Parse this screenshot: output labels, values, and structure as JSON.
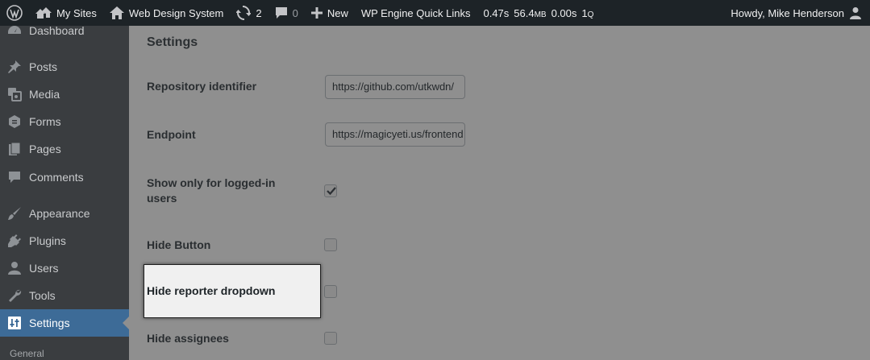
{
  "adminbar": {
    "my_sites": "My Sites",
    "site_name": "Web Design System",
    "updates_count": "2",
    "comments_count": "0",
    "new_label": "New",
    "wp_engine": "WP Engine Quick Links",
    "perf_time": "0.47s",
    "perf_memory_value": "56.4",
    "perf_memory_unit": "MB",
    "perf_db_time": "0.00s",
    "perf_queries_value": "1",
    "perf_queries_unit": "Q",
    "howdy": "Howdy, Mike Henderson"
  },
  "sidebar": {
    "items": [
      {
        "label": "Dashboard",
        "icon": "dashboard-icon"
      },
      {
        "label": "Posts",
        "icon": "pin-icon"
      },
      {
        "label": "Media",
        "icon": "media-icon"
      },
      {
        "label": "Forms",
        "icon": "forms-icon"
      },
      {
        "label": "Pages",
        "icon": "pages-icon"
      },
      {
        "label": "Comments",
        "icon": "comment-icon"
      },
      {
        "label": "Appearance",
        "icon": "brush-icon"
      },
      {
        "label": "Plugins",
        "icon": "plug-icon"
      },
      {
        "label": "Users",
        "icon": "user-icon"
      },
      {
        "label": "Tools",
        "icon": "wrench-icon"
      },
      {
        "label": "Settings",
        "icon": "settings-icon",
        "current": true
      }
    ],
    "submenu": [
      "General"
    ],
    "colors": {
      "background": "#3a3d40",
      "current": "#3d6b97"
    }
  },
  "main": {
    "title": "Settings",
    "fields": {
      "repository": {
        "label": "Repository identifier",
        "value": "https://github.com/utkwdn/"
      },
      "endpoint": {
        "label": "Endpoint",
        "value": "https://magicyeti.us/frontend"
      },
      "logged_in": {
        "label": "Show only for logged-in users",
        "checked": true
      },
      "hide_button": {
        "label": "Hide Button",
        "checked": false
      },
      "hide_reporter": {
        "label": "Hide reporter dropdown",
        "checked": false
      },
      "hide_assignees": {
        "label": "Hide assignees",
        "checked": false
      }
    }
  }
}
